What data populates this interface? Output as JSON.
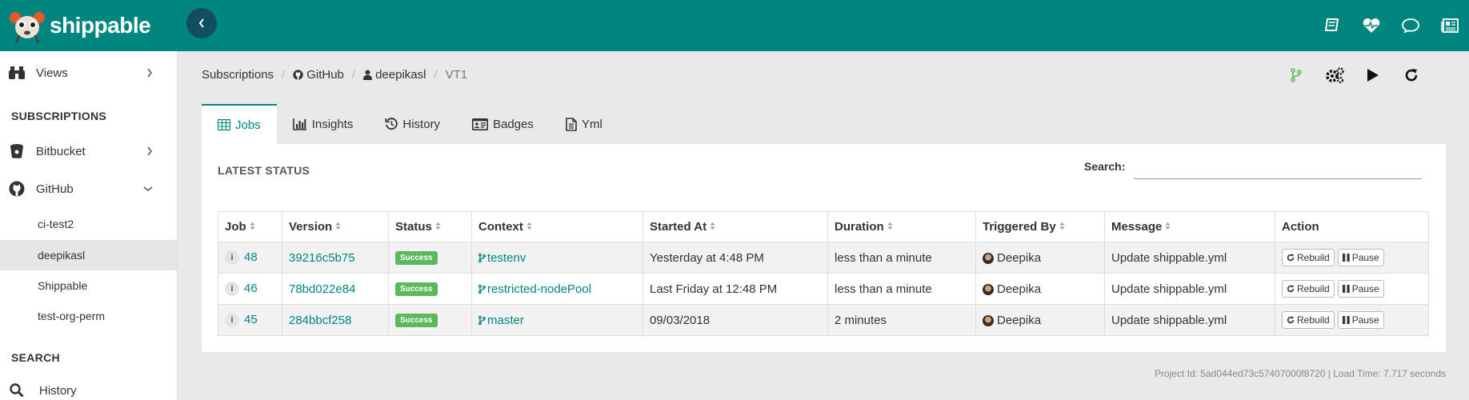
{
  "brand": {
    "name": "shippable"
  },
  "sidebar": {
    "views_label": "Views",
    "subscriptions_heading": "SUBSCRIPTIONS",
    "bitbucket_label": "Bitbucket",
    "github_label": "GitHub",
    "github_orgs": [
      "ci-test2",
      "deepikasl",
      "Shippable",
      "test-org-perm"
    ],
    "search_heading": "SEARCH",
    "history_label": "History"
  },
  "breadcrumb": {
    "subscriptions": "Subscriptions",
    "provider": "GitHub",
    "owner": "deepikasl",
    "project": "VT1"
  },
  "tabs": [
    "Jobs",
    "Insights",
    "History",
    "Badges",
    "Yml"
  ],
  "panel": {
    "heading": "LATEST STATUS",
    "search_label": "Search:",
    "search_value": ""
  },
  "table": {
    "headers": [
      "Job",
      "Version",
      "Status",
      "Context",
      "Started At",
      "Duration",
      "Triggered By",
      "Message",
      "Action"
    ],
    "rows": [
      {
        "job": "48",
        "version": "39216c5b75",
        "status": "Success",
        "context": "testenv",
        "started": "Yesterday at 4:48 PM",
        "duration": "less than a minute",
        "triggered": "Deepika",
        "message": "Update shippable.yml"
      },
      {
        "job": "46",
        "version": "78bd022e84",
        "status": "Success",
        "context": "restricted-nodePool",
        "started": "Last Friday at 12:48 PM",
        "duration": "less than a minute",
        "triggered": "Deepika",
        "message": "Update shippable.yml"
      },
      {
        "job": "45",
        "version": "284bbcf258",
        "status": "Success",
        "context": "master",
        "started": "09/03/2018",
        "duration": "2 minutes",
        "triggered": "Deepika",
        "message": "Update shippable.yml"
      }
    ],
    "rebuild_label": "Rebuild",
    "pause_label": "Pause",
    "info_glyph": "i"
  },
  "footer": {
    "text": "Project Id: 5ad044ed73c57407000f8720 | Load Time: 7.717 seconds"
  },
  "colors": {
    "topbar": "#00857f",
    "accent": "#00857f",
    "success": "#5cb85c",
    "collapse_button": "#114e5f"
  },
  "icons": [
    "book-icon",
    "heartbeat-icon",
    "chat-icon",
    "newspaper-icon",
    "binoculars-icon",
    "bucket-icon",
    "github-icon",
    "search-icon",
    "branch-icon",
    "gears-icon",
    "play-icon",
    "refresh-icon",
    "table-icon",
    "bar-chart-icon",
    "history-icon",
    "id-card-icon",
    "file-icon"
  ]
}
